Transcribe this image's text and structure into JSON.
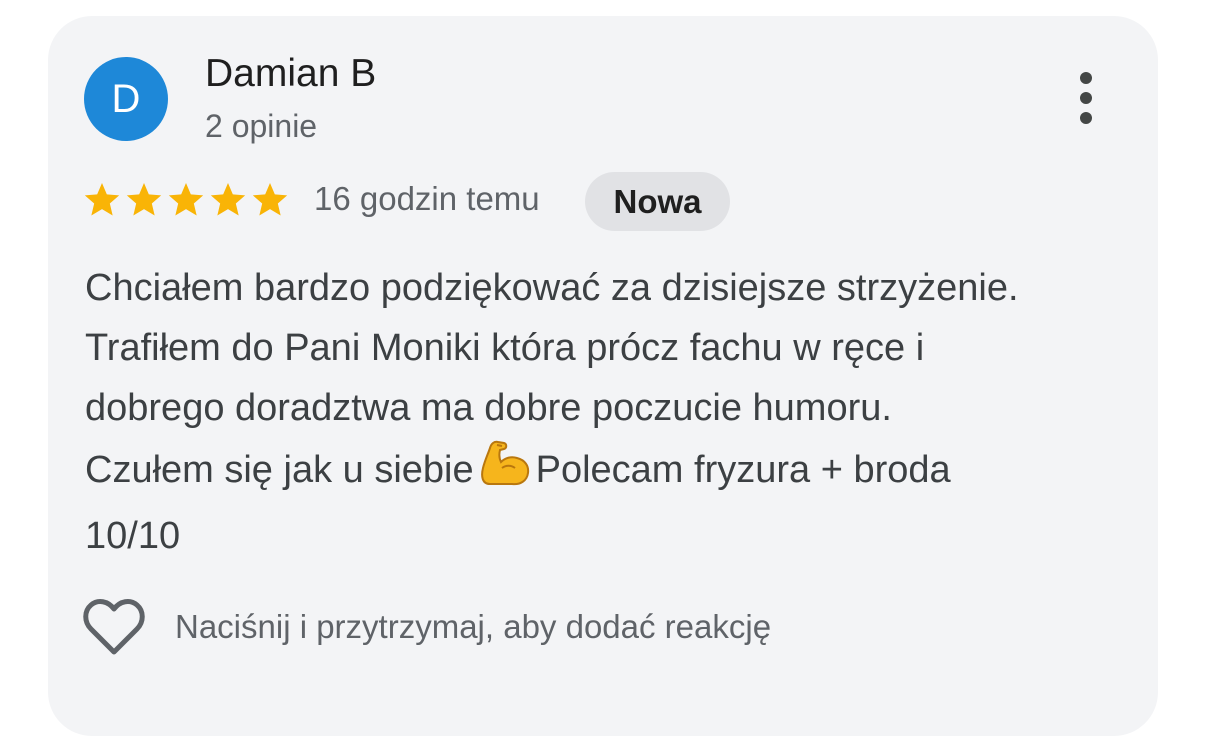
{
  "review": {
    "avatar_letter": "D",
    "avatar_color": "#1e88d8",
    "reviewer_name": "Damian B",
    "reviewer_reviews_count": "2 opinie",
    "more_icon": "more-vert-icon",
    "rating": 5,
    "rating_max": 5,
    "star_color": "#f9b406",
    "time_ago": "16 godzin temu",
    "badge_label": "Nowa",
    "text_lines": [
      "Chciałem bardzo podziękować za dzisiejsze strzyżenie.",
      "Trafiłem do Pani Moniki która prócz fachu w ręce i",
      "dobrego doradztwa ma dobre poczucie humoru."
    ],
    "text_line4_before_emoji": "Czułem się jak u siebie",
    "text_emoji": "flexed-biceps",
    "text_line4_after_emoji": "Polecam fryzura + broda",
    "text_line5": "10/10",
    "reaction_icon": "heart-outline-icon",
    "reaction_hint": "Naciśnij i przytrzymaj, aby dodać reakcję"
  }
}
